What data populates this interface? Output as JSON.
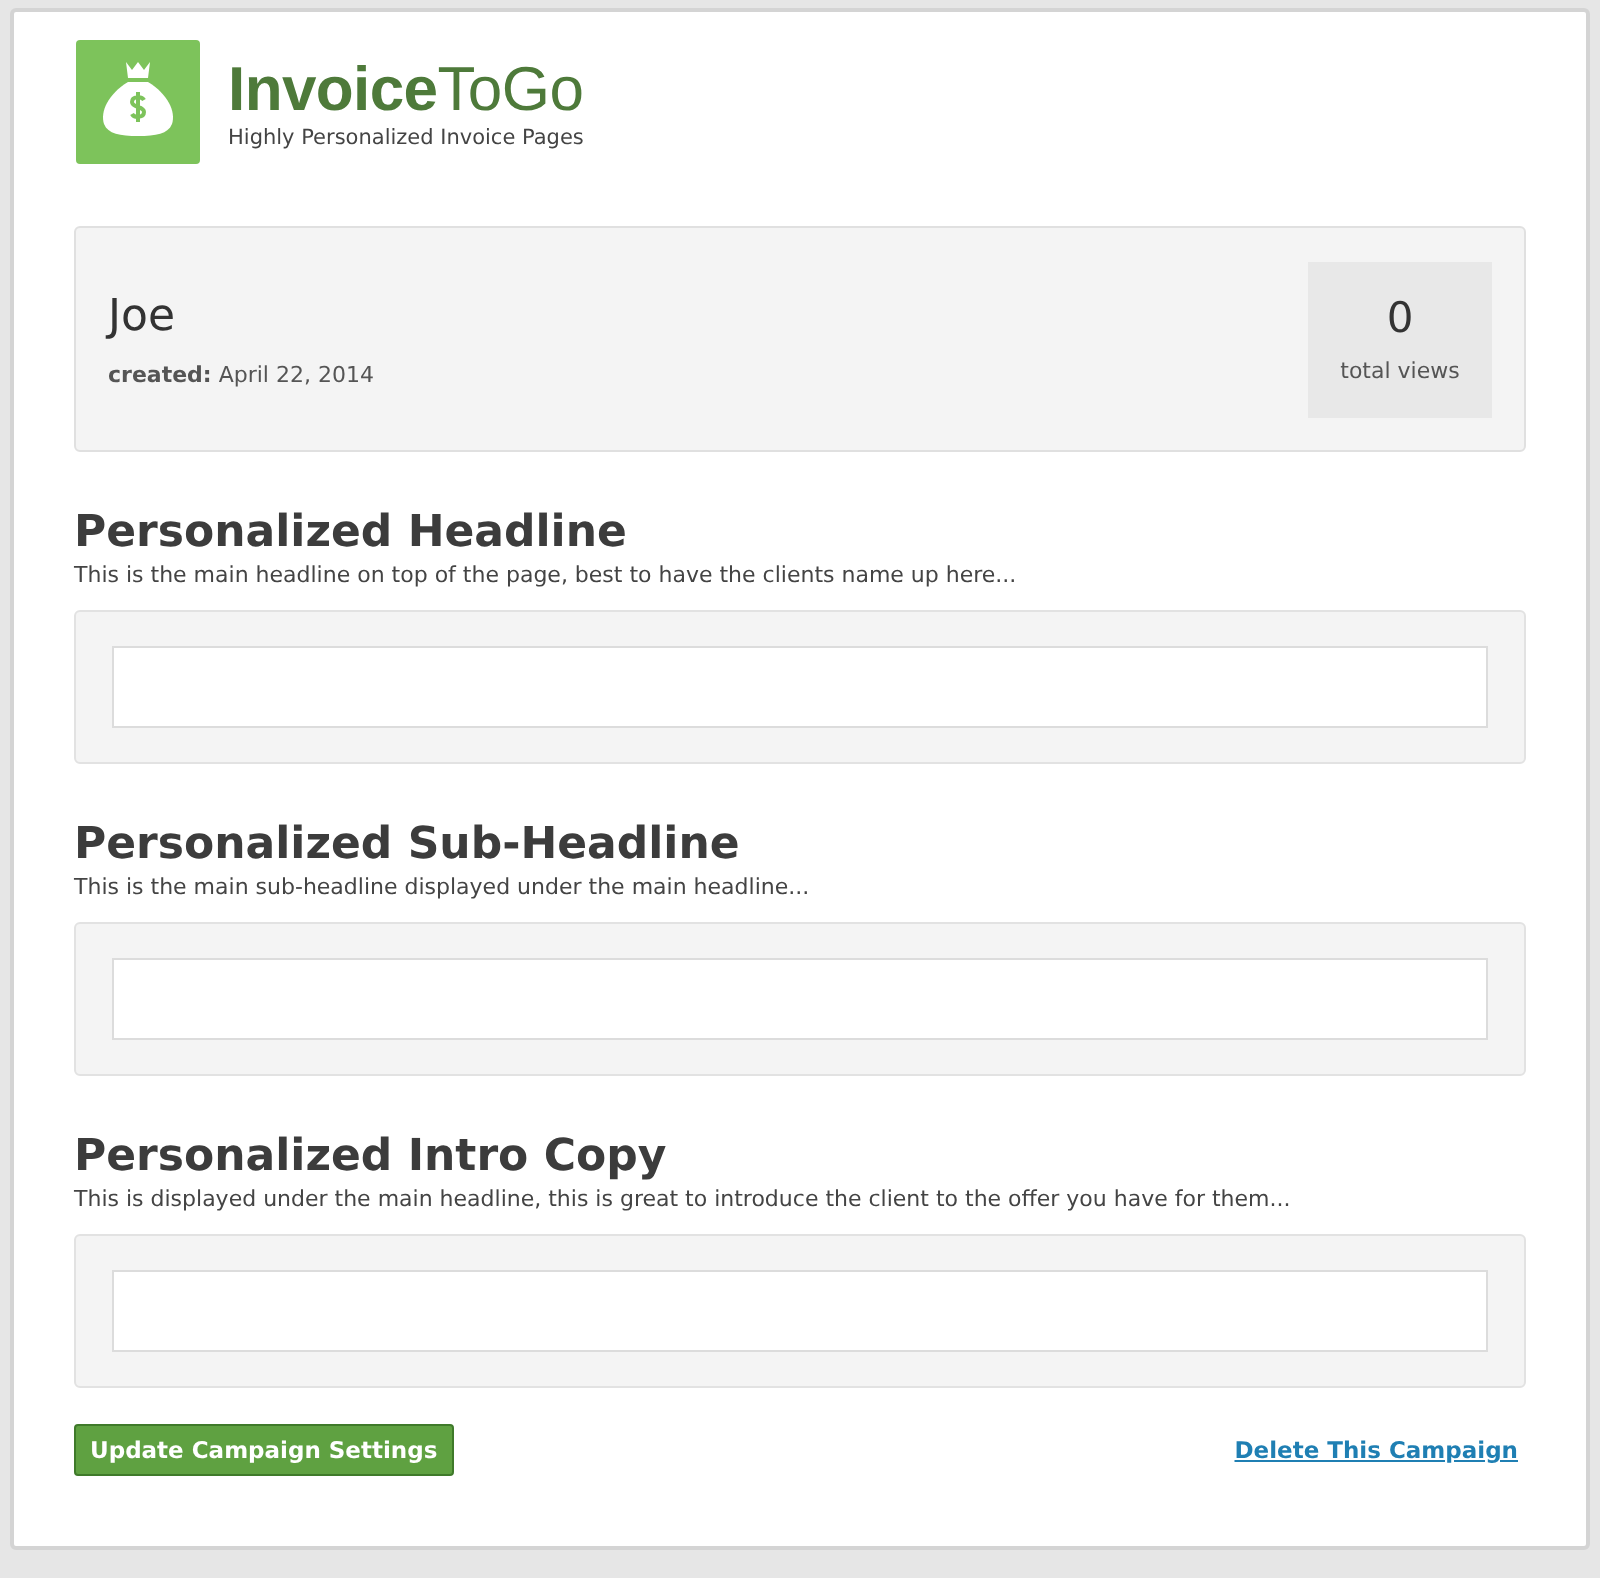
{
  "brand": {
    "name": "**Invoice**ToGo",
    "tagline": "Highly Personalized Invoice Pages"
  },
  "campaign": {
    "name": "Joe",
    "created": "**created:** April 22, 2014",
    "views": "0",
    "views_label": "total views"
  },
  "sections": [
    {
      "title": "Personalized Headline",
      "description": "This is the main headline on top of the page, best to have the clients name up here..."
    },
    {
      "title": "Personalized Sub-Headline",
      "description": "This is the main sub-headline displayed under the main headline..."
    },
    {
      "title": "Personalized Intro Copy",
      "description": "This is displayed under the main headline, this is great to introduce the client to the offer you have for them..."
    }
  ],
  "actions": {
    "primary": "Update Campaign Settings",
    "delete_link": "Delete This Campaign"
  }
}
